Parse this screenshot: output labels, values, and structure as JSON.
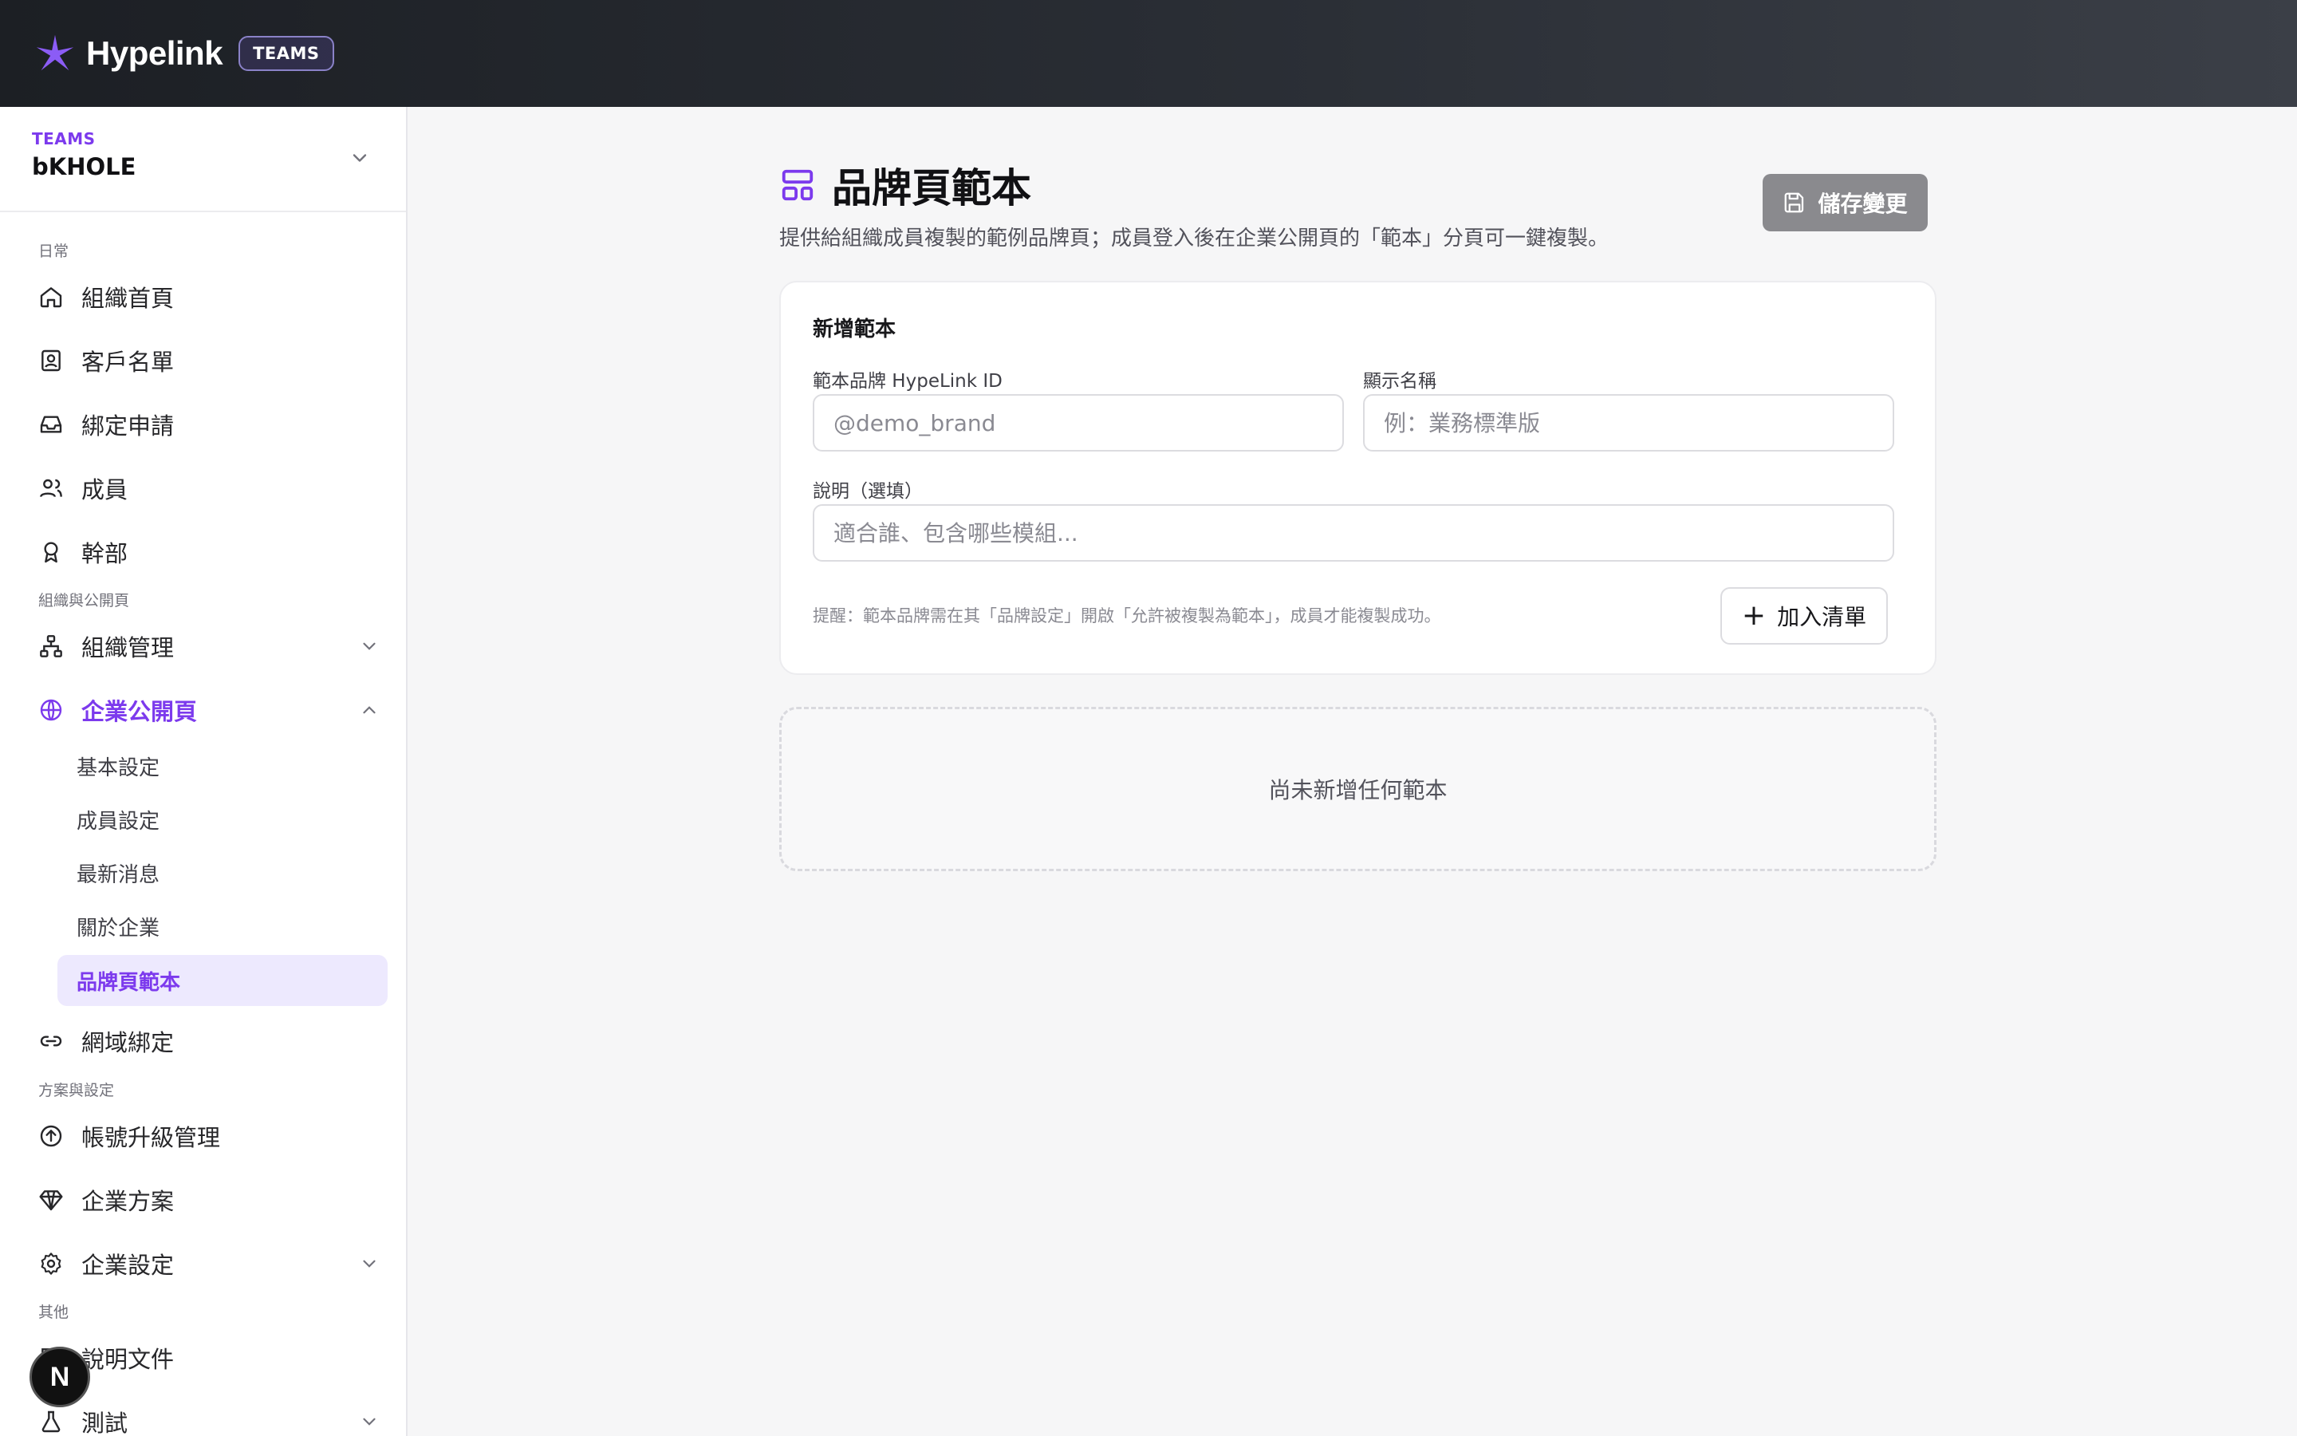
{
  "app": {
    "name": "Hypelink",
    "badge": "TEAMS"
  },
  "org": {
    "kicker": "TEAMS",
    "name": "bKHOLE"
  },
  "sidebar": {
    "section_daily": "日常",
    "home": "組織首頁",
    "customers": "客戶名單",
    "binding_requests": "綁定申請",
    "members": "成員",
    "officers": "幹部",
    "section_org": "組織與公開頁",
    "org_manage": "組織管理",
    "public_page": "企業公開頁",
    "sub_basic": "基本設定",
    "sub_members": "成員設定",
    "sub_news": "最新消息",
    "sub_about": "關於企業",
    "sub_templates": "品牌頁範本",
    "domain_binding": "網域綁定",
    "section_plan": "方案與設定",
    "account_upgrade": "帳號升級管理",
    "enterprise_plan": "企業方案",
    "enterprise_settings": "企業設定",
    "section_other": "其他",
    "docs": "說明文件",
    "test": "測試",
    "avatar_letter": "N"
  },
  "page": {
    "title": "品牌頁範本",
    "description": "提供給組織成員複製的範例品牌頁；成員登入後在企業公開頁的「範本」分頁可一鍵複製。",
    "save_label": "儲存變更"
  },
  "form": {
    "title": "新增範本",
    "id_label": "範本品牌 HypeLink ID",
    "id_placeholder": "@demo_brand",
    "name_label": "顯示名稱",
    "name_placeholder": "例：業務標準版",
    "desc_label": "說明（選填）",
    "desc_placeholder": "適合誰、包含哪些模組...",
    "hint": "提醒：範本品牌需在其「品牌設定」開啟「允許被複製為範本」，成員才能複製成功。",
    "add_label": "加入清單"
  },
  "empty_state": "尚未新增任何範本",
  "colors": {
    "accent": "#7c3aed",
    "save_button": "#8a8a8e"
  }
}
